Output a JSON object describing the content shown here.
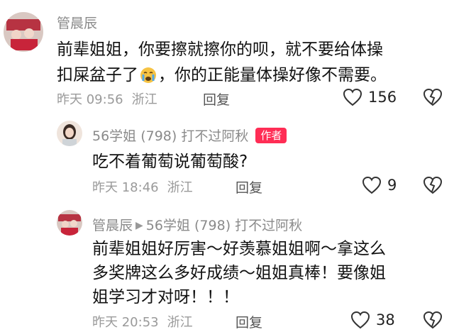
{
  "comments": [
    {
      "author": "管晨辰",
      "text_line1": "前辈姐姐，你要擦就擦你的呗，就不要给体操",
      "text_line2a": "扣屎盆子了",
      "text_line2b": "，你的正能量体操好像不需要。",
      "time": "昨天 09:56",
      "location": "浙江",
      "reply_label": "回复",
      "likes": "156"
    },
    {
      "author": "56学姐 (798) 打不过阿秋",
      "badge": "作者",
      "text": "吃不着葡萄说葡萄酸?",
      "time": "昨天 18:46",
      "location": "浙江",
      "reply_label": "回复",
      "likes": "9"
    },
    {
      "author": "管晨辰",
      "reply_to": "56学姐 (798) 打不过阿秋",
      "text_line1": "前辈姐姐好厉害～好羡慕姐姐啊～拿这么",
      "text_line2": "多奖牌这么多好成绩～姐姐真棒！要像姐",
      "text_line3": "姐学习才对呀！！！",
      "time": "昨天 20:53",
      "location": "浙江",
      "reply_label": "回复",
      "likes": "38"
    }
  ],
  "icons": {
    "like": "heart-outline-icon",
    "dislike": "broken-heart-icon",
    "crying_emoji": "crying-face-emoji"
  },
  "colors": {
    "badge": "#ff2d55",
    "meta": "#9a9a9a"
  }
}
